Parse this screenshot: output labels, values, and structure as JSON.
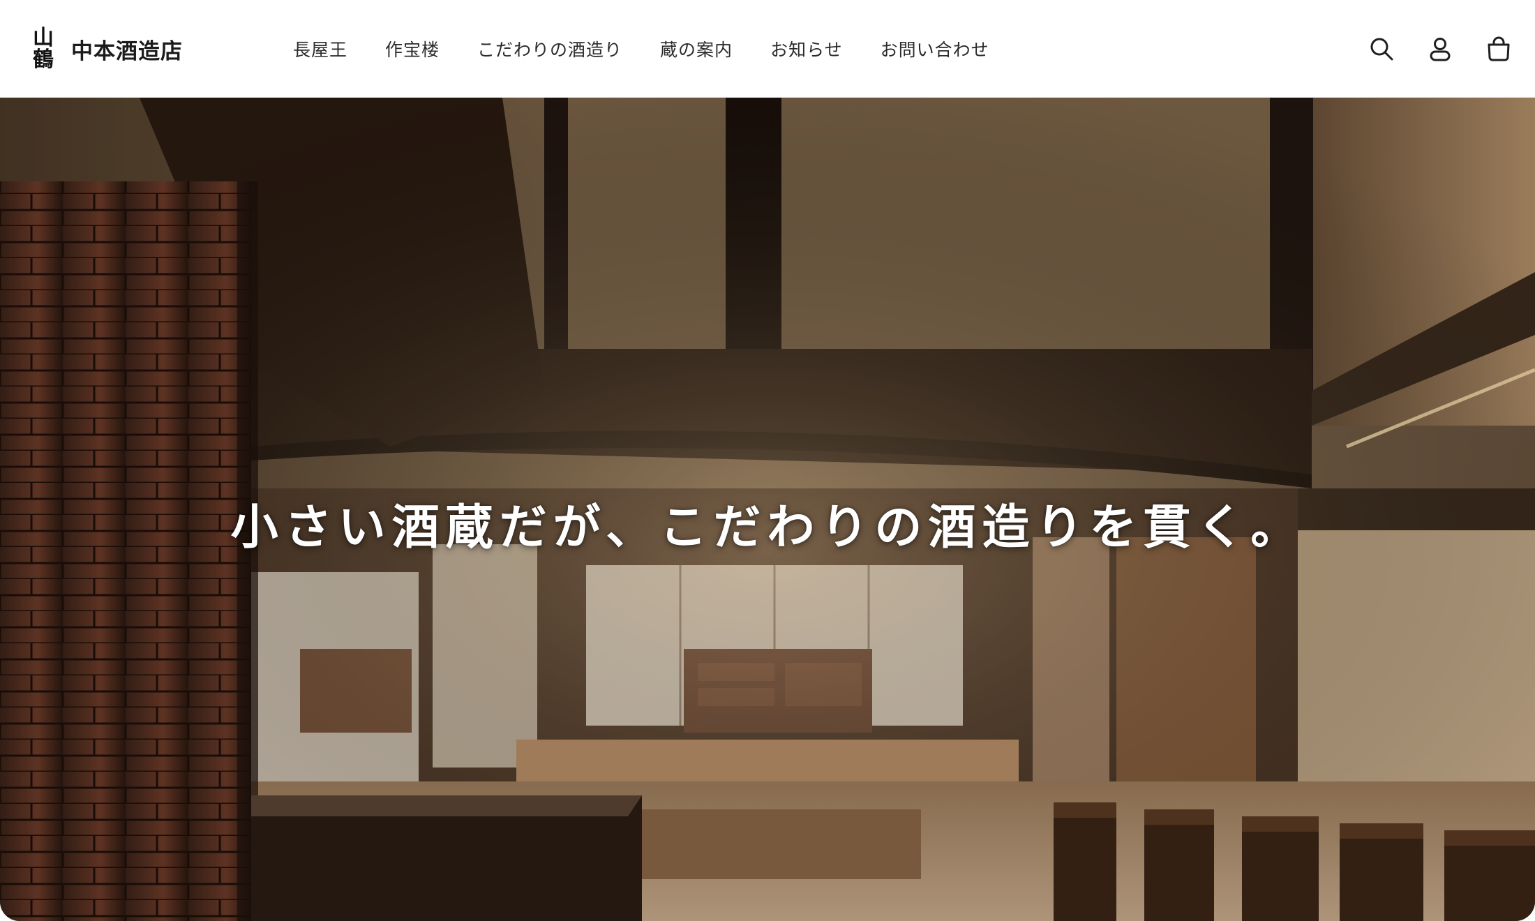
{
  "header": {
    "logo_mark_top": "山",
    "logo_mark_bottom": "鶴",
    "brand_name": "中本酒造店"
  },
  "nav": {
    "items": [
      "長屋王",
      "作宝楼",
      "こだわりの酒造り",
      "蔵の案内",
      "お知らせ",
      "お問い合わせ"
    ]
  },
  "icons": [
    "search-icon",
    "account-icon",
    "cart-icon"
  ],
  "hero": {
    "tagline": "小さい酒蔵だが、こだわりの酒造りを貫く。"
  },
  "colors": {
    "header_bg": "#ffffff",
    "nav_text": "#2b2b2b",
    "hero_text": "#ffffff",
    "wood_dark": "#2a1c12",
    "plaster": "#8a7256"
  }
}
